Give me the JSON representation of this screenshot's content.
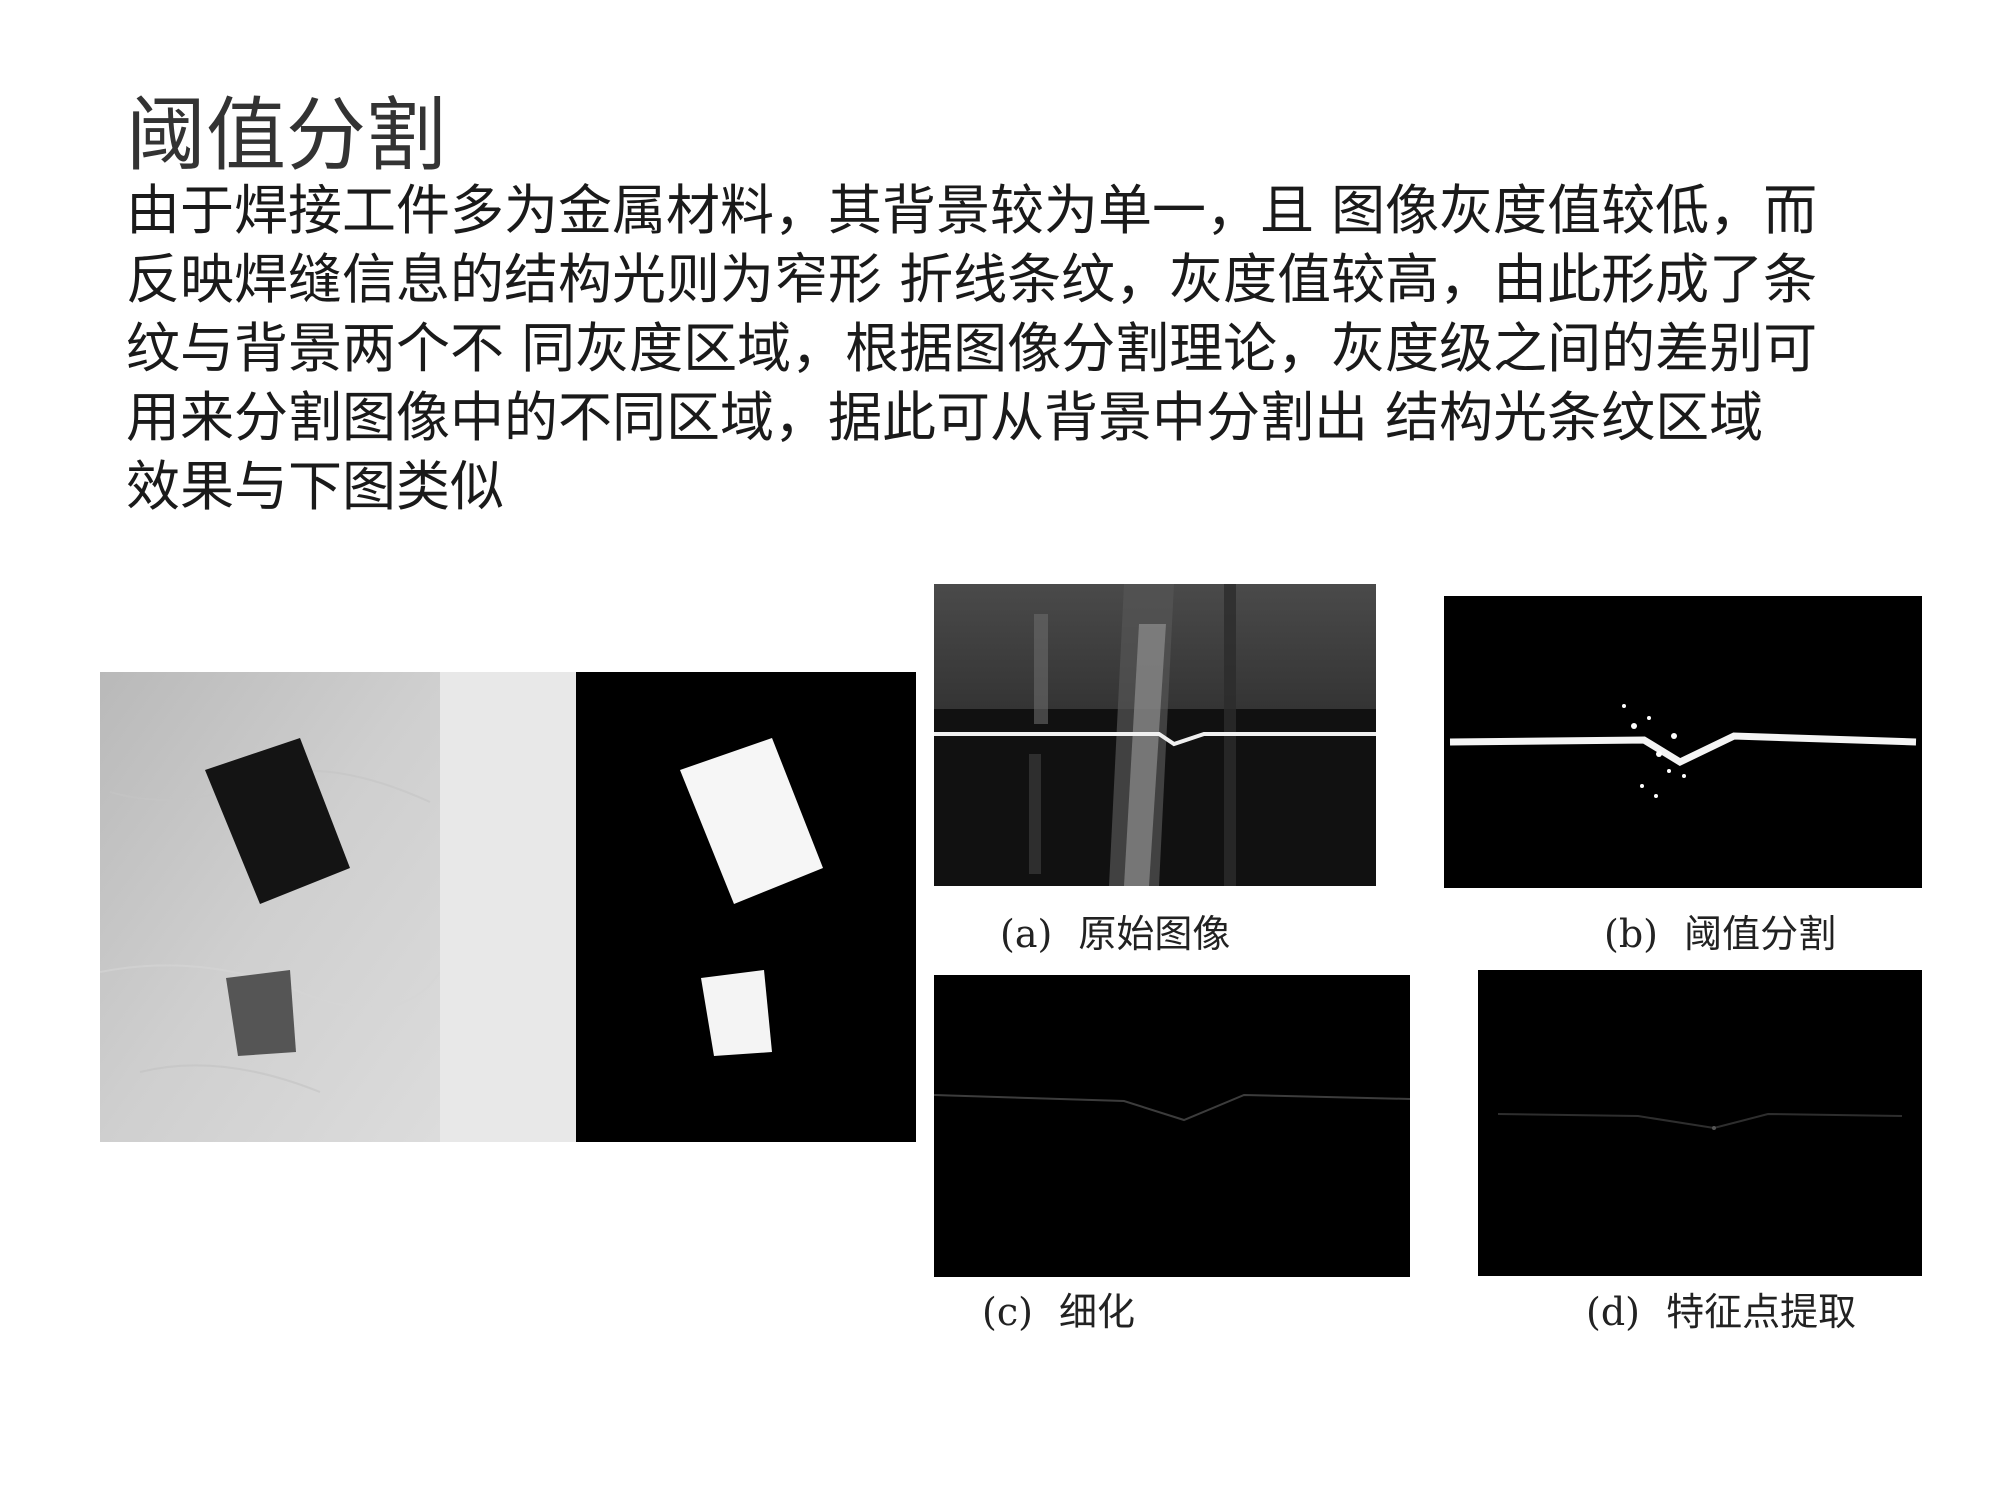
{
  "slide": {
    "title": "阈值分割",
    "body_lines": [
      "由于焊接工件多为金属材料，其背景较为单一，且 图像灰度值较低，而",
      "反映焊缝信息的结构光则为窄形 折线条纹，灰度值较高，由此形成了条",
      "纹与背景两个不 同灰度区域，根据图像分割理论，灰度级之间的差别可",
      "用来分割图像中的不同区域，据此可从背景中分割出 结构光条纹区域",
      "效果与下图类似"
    ]
  },
  "figure_captions": {
    "a": {
      "label": "(a)",
      "text": "原始图像"
    },
    "b": {
      "label": "(b)",
      "text": "阈值分割"
    },
    "c": {
      "label": "(c)",
      "text": "细化"
    },
    "d": {
      "label": "(d)",
      "text": "特征点提取"
    }
  },
  "colors": {
    "black_panel": "#000000",
    "paper_gray": "#c8c8c8",
    "divider_light": "#e8e8e8",
    "stripe_white": "#f4f4f4"
  }
}
